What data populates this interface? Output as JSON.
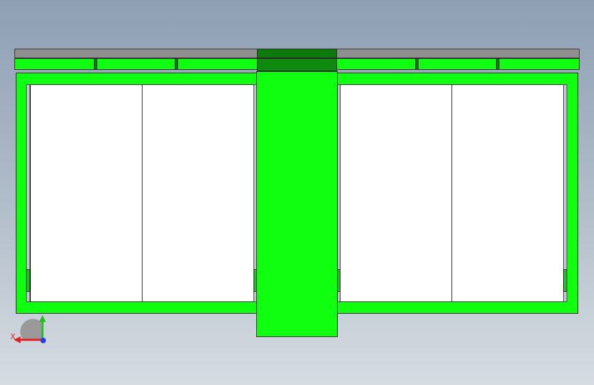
{
  "colors": {
    "frame_green": "#10ff10",
    "dark_green": "#0c7a0c",
    "mid_green": "#17c617",
    "rail_gray": "#8f8f8f",
    "glass": "#ffffff",
    "axis_x": "#e02020",
    "axis_y": "#20c020",
    "axis_z": "#2040e0"
  },
  "triad": {
    "x_label": "X"
  }
}
